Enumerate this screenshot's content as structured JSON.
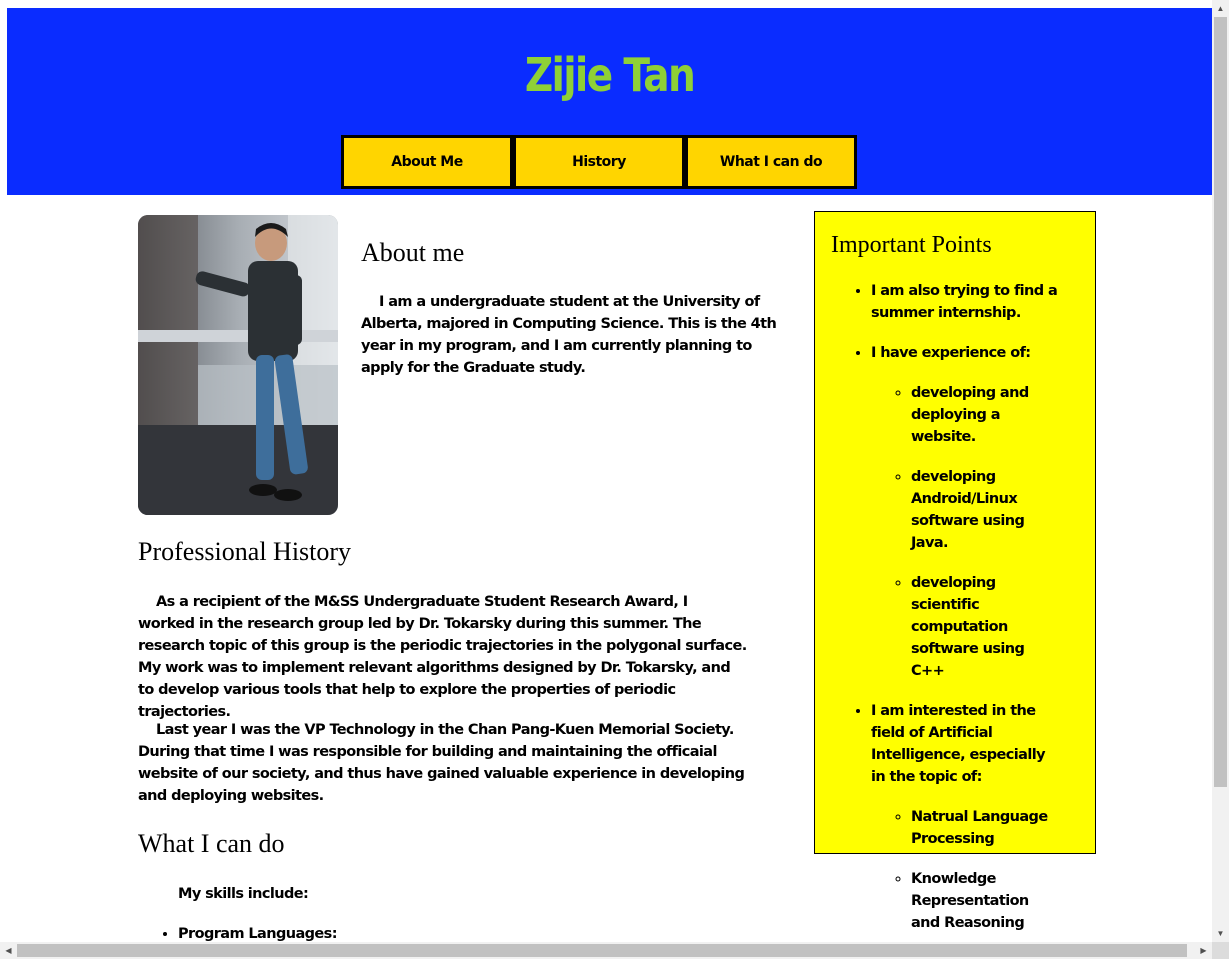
{
  "header": {
    "title": "Zijie Tan",
    "nav": [
      "About Me",
      "History",
      "What I can do"
    ],
    "bg_color": "#0a2cff",
    "title_color": "#8fd036",
    "nav_color": "#ffd500"
  },
  "about": {
    "heading": "About me",
    "text": "I am a undergraduate student at the University of Alberta, majored in Computing Science. This is the 4th year in my program, and I am currently planning to apply for the Graduate study."
  },
  "history": {
    "heading": "Professional History",
    "paragraphs": [
      "As a recipient of the M&SS Undergraduate Student Research Award, I worked in the research group led by Dr. Tokarsky during this summer. The research topic of this group is the periodic trajectories in the polygonal surface. My work was to implement relevant algorithms designed by Dr. Tokarsky, and to develop various tools that help to explore the properties of periodic trajectories.",
      "Last year I was the VP Technology in the Chan Pang-Kuen Memorial Society. During that time I was responsible for building and maintaining the officaial website of our society, and thus have gained valuable experience in developing and deploying websites."
    ]
  },
  "cando": {
    "heading": "What I can do",
    "intro": "My skills include:",
    "items": [
      "Program Languages:"
    ]
  },
  "aside": {
    "heading": "Important Points",
    "bg_color": "#ffff00",
    "points": [
      "I am also trying to find a summer internship.",
      "I have experience of:",
      "I am interested in the field of Artificial Intelligence, especially in the topic of:"
    ],
    "experience": [
      "developing and deploying a website.",
      "developing Android/Linux software using Java.",
      "developing scientific computation software using C++"
    ],
    "interests": [
      "Natrual Language Processing",
      "Knowledge Representation and Reasoning"
    ]
  }
}
